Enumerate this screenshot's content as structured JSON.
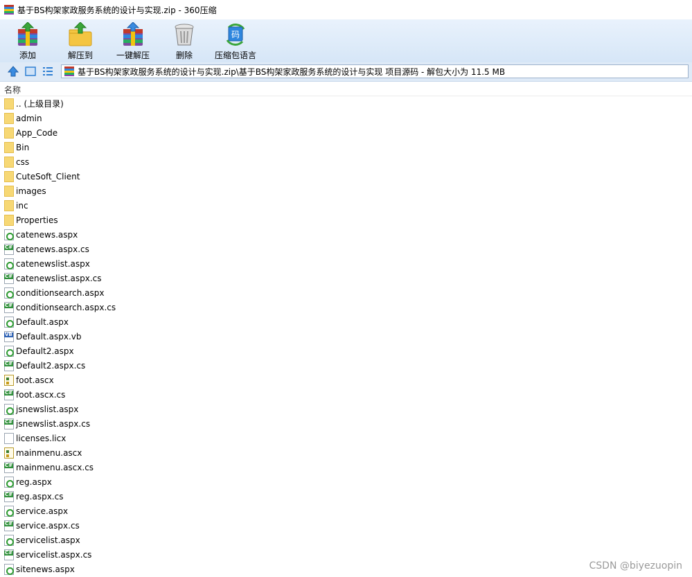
{
  "window": {
    "title": "基于BS构架家政服务系统的设计与实现.zip - 360压缩"
  },
  "toolbar": {
    "items": [
      {
        "label": "添加",
        "icon": "add-archive-icon"
      },
      {
        "label": "解压到",
        "icon": "extract-to-icon"
      },
      {
        "label": "一键解压",
        "icon": "one-click-extract-icon"
      },
      {
        "label": "删除",
        "icon": "delete-icon"
      },
      {
        "label": "压缩包语言",
        "icon": "archive-language-icon"
      }
    ]
  },
  "nav": {
    "path": "基于BS构架家政服务系统的设计与实现.zip\\基于BS构架家政服务系统的设计与实现 项目源码 - 解包大小为 11.5 MB"
  },
  "list": {
    "column_name": "名称",
    "rows": [
      {
        "name": ".. (上级目录)",
        "type": "folder"
      },
      {
        "name": "admin",
        "type": "folder"
      },
      {
        "name": "App_Code",
        "type": "folder"
      },
      {
        "name": "Bin",
        "type": "folder"
      },
      {
        "name": "css",
        "type": "folder"
      },
      {
        "name": "CuteSoft_Client",
        "type": "folder"
      },
      {
        "name": "images",
        "type": "folder"
      },
      {
        "name": "inc",
        "type": "folder"
      },
      {
        "name": "Properties",
        "type": "folder"
      },
      {
        "name": "catenews.aspx",
        "type": "aspx"
      },
      {
        "name": "catenews.aspx.cs",
        "type": "cs"
      },
      {
        "name": "catenewslist.aspx",
        "type": "aspx"
      },
      {
        "name": "catenewslist.aspx.cs",
        "type": "cs"
      },
      {
        "name": "conditionsearch.aspx",
        "type": "aspx"
      },
      {
        "name": "conditionsearch.aspx.cs",
        "type": "cs"
      },
      {
        "name": "Default.aspx",
        "type": "aspx"
      },
      {
        "name": "Default.aspx.vb",
        "type": "vb"
      },
      {
        "name": "Default2.aspx",
        "type": "aspx"
      },
      {
        "name": "Default2.aspx.cs",
        "type": "cs"
      },
      {
        "name": "foot.ascx",
        "type": "ascx"
      },
      {
        "name": "foot.ascx.cs",
        "type": "cs"
      },
      {
        "name": "jsnewslist.aspx",
        "type": "aspx"
      },
      {
        "name": "jsnewslist.aspx.cs",
        "type": "cs"
      },
      {
        "name": "licenses.licx",
        "type": "file"
      },
      {
        "name": "mainmenu.ascx",
        "type": "ascx"
      },
      {
        "name": "mainmenu.ascx.cs",
        "type": "cs"
      },
      {
        "name": "reg.aspx",
        "type": "aspx"
      },
      {
        "name": "reg.aspx.cs",
        "type": "cs"
      },
      {
        "name": "service.aspx",
        "type": "aspx"
      },
      {
        "name": "service.aspx.cs",
        "type": "cs"
      },
      {
        "name": "servicelist.aspx",
        "type": "aspx"
      },
      {
        "name": "servicelist.aspx.cs",
        "type": "cs"
      },
      {
        "name": "sitenews.aspx",
        "type": "aspx"
      }
    ]
  },
  "watermark": "CSDN @biyezuopin",
  "colors": {
    "toolbar_bg": "#dce9f8",
    "folder": "#f7d875",
    "accent_blue": "#2f7fd3"
  }
}
